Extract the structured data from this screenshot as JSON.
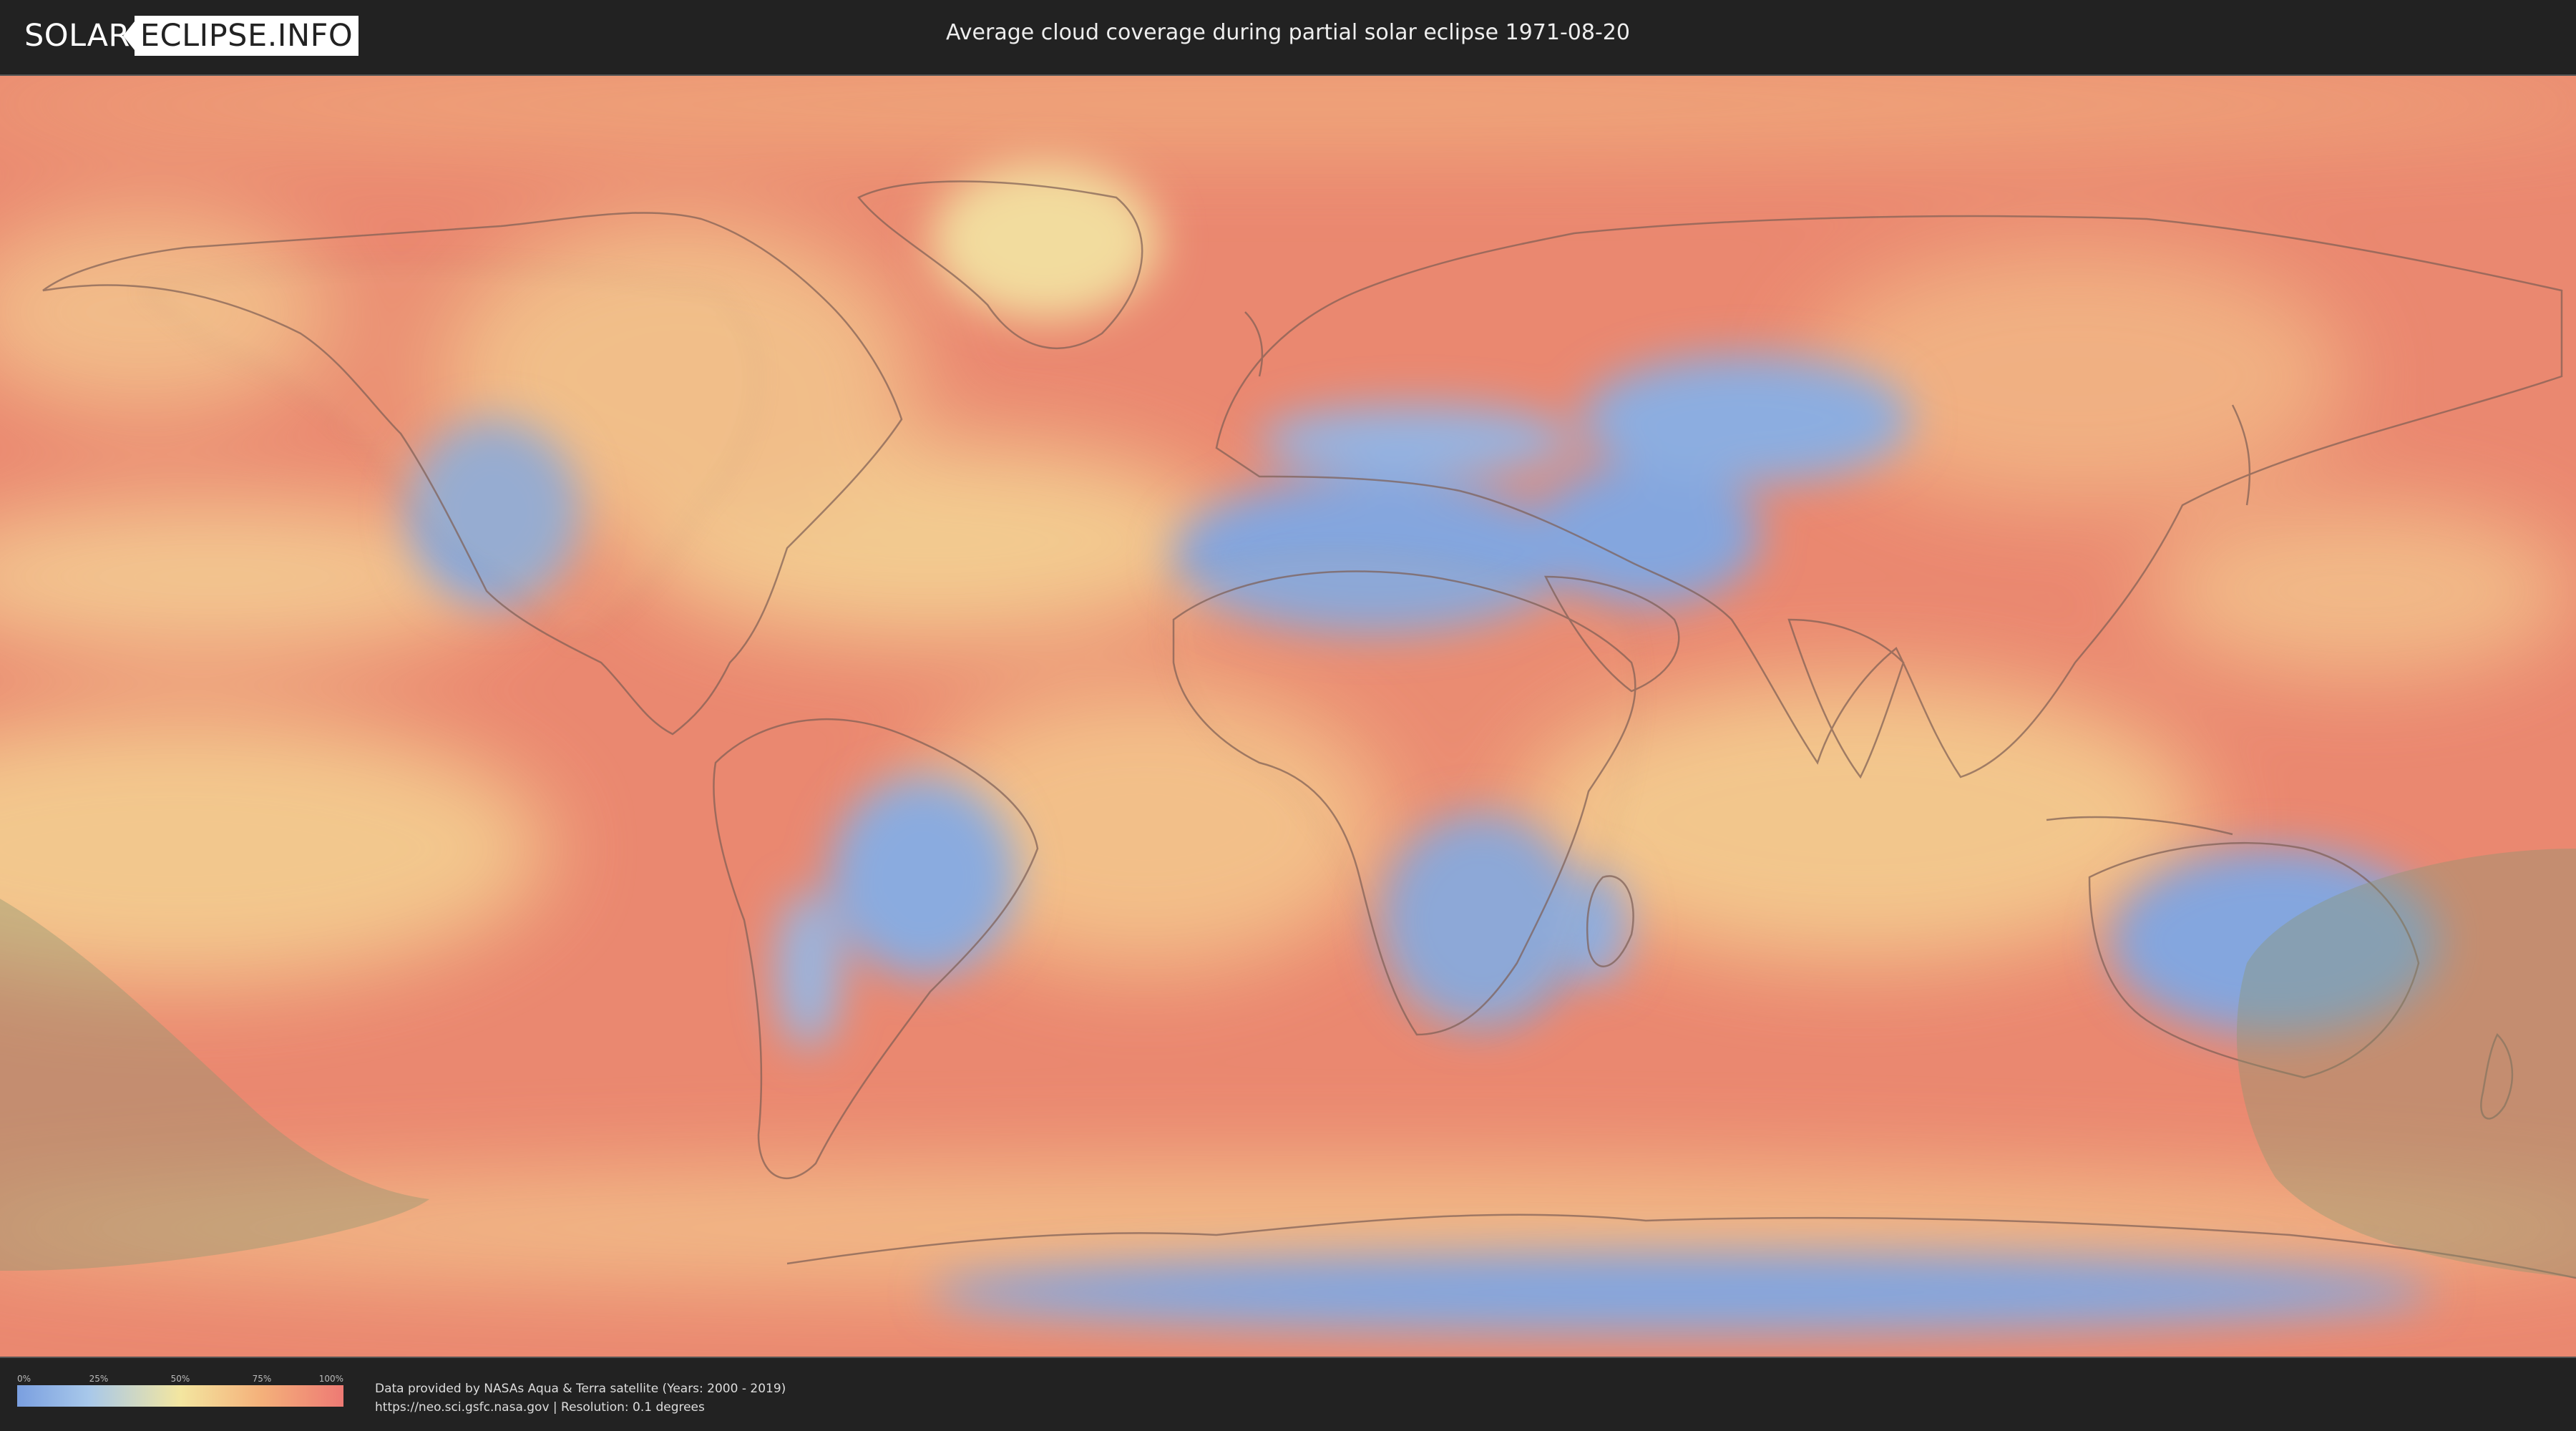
{
  "header": {
    "logo_left": "SOLAR",
    "logo_right": "ECLIPSE.INFO",
    "title": "Average cloud coverage during partial solar eclipse 1971-08-20"
  },
  "legend": {
    "ticks": [
      "0%",
      "25%",
      "50%",
      "75%",
      "100%"
    ],
    "tick_fractions": [
      0,
      0.25,
      0.5,
      0.75,
      1.0
    ],
    "colors": [
      "#7a9fe0",
      "#a8c8ea",
      "#f3e6a0",
      "#f4b07a",
      "#ee7a74"
    ]
  },
  "credits": {
    "line1": "Data provided by NASAs Aqua & Terra satellite (Years: 2000 - 2019)",
    "line2": "https://neo.sci.gsfc.nasa.gov | Resolution: 0.1 degrees"
  },
  "map": {
    "projection": "equirectangular",
    "ocean_color": "#ea8870",
    "low_cloud_color": "#84a6de",
    "mid_cloud_color": "#f4dc9a",
    "land_outline_color": "#8a6a5a",
    "eclipse_shadow_color": "#8c9670"
  }
}
